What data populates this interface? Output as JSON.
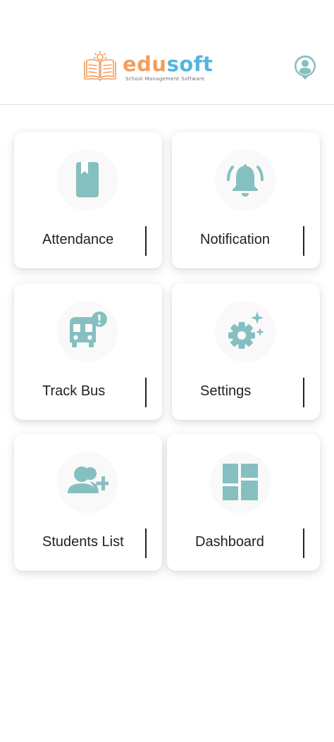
{
  "header": {
    "brand_part1": "edu",
    "brand_part2": "soft",
    "tagline": "School Management Software",
    "profile_icon": "account-circle-icon"
  },
  "colors": {
    "accent": "#86bfc0",
    "brand_orange": "#f29e5e",
    "brand_blue": "#52b7dc",
    "text": "#222222"
  },
  "menu": {
    "items": [
      {
        "label": "Attendance",
        "icon": "book-icon"
      },
      {
        "label": "Notification",
        "icon": "bell-icon"
      },
      {
        "label": "Track Bus",
        "icon": "bus-alert-icon"
      },
      {
        "label": "Settings",
        "icon": "gear-sparkle-icon"
      },
      {
        "label": "Students List",
        "icon": "add-user-icon"
      },
      {
        "label": "Dashboard",
        "icon": "dashboard-icon"
      }
    ]
  }
}
